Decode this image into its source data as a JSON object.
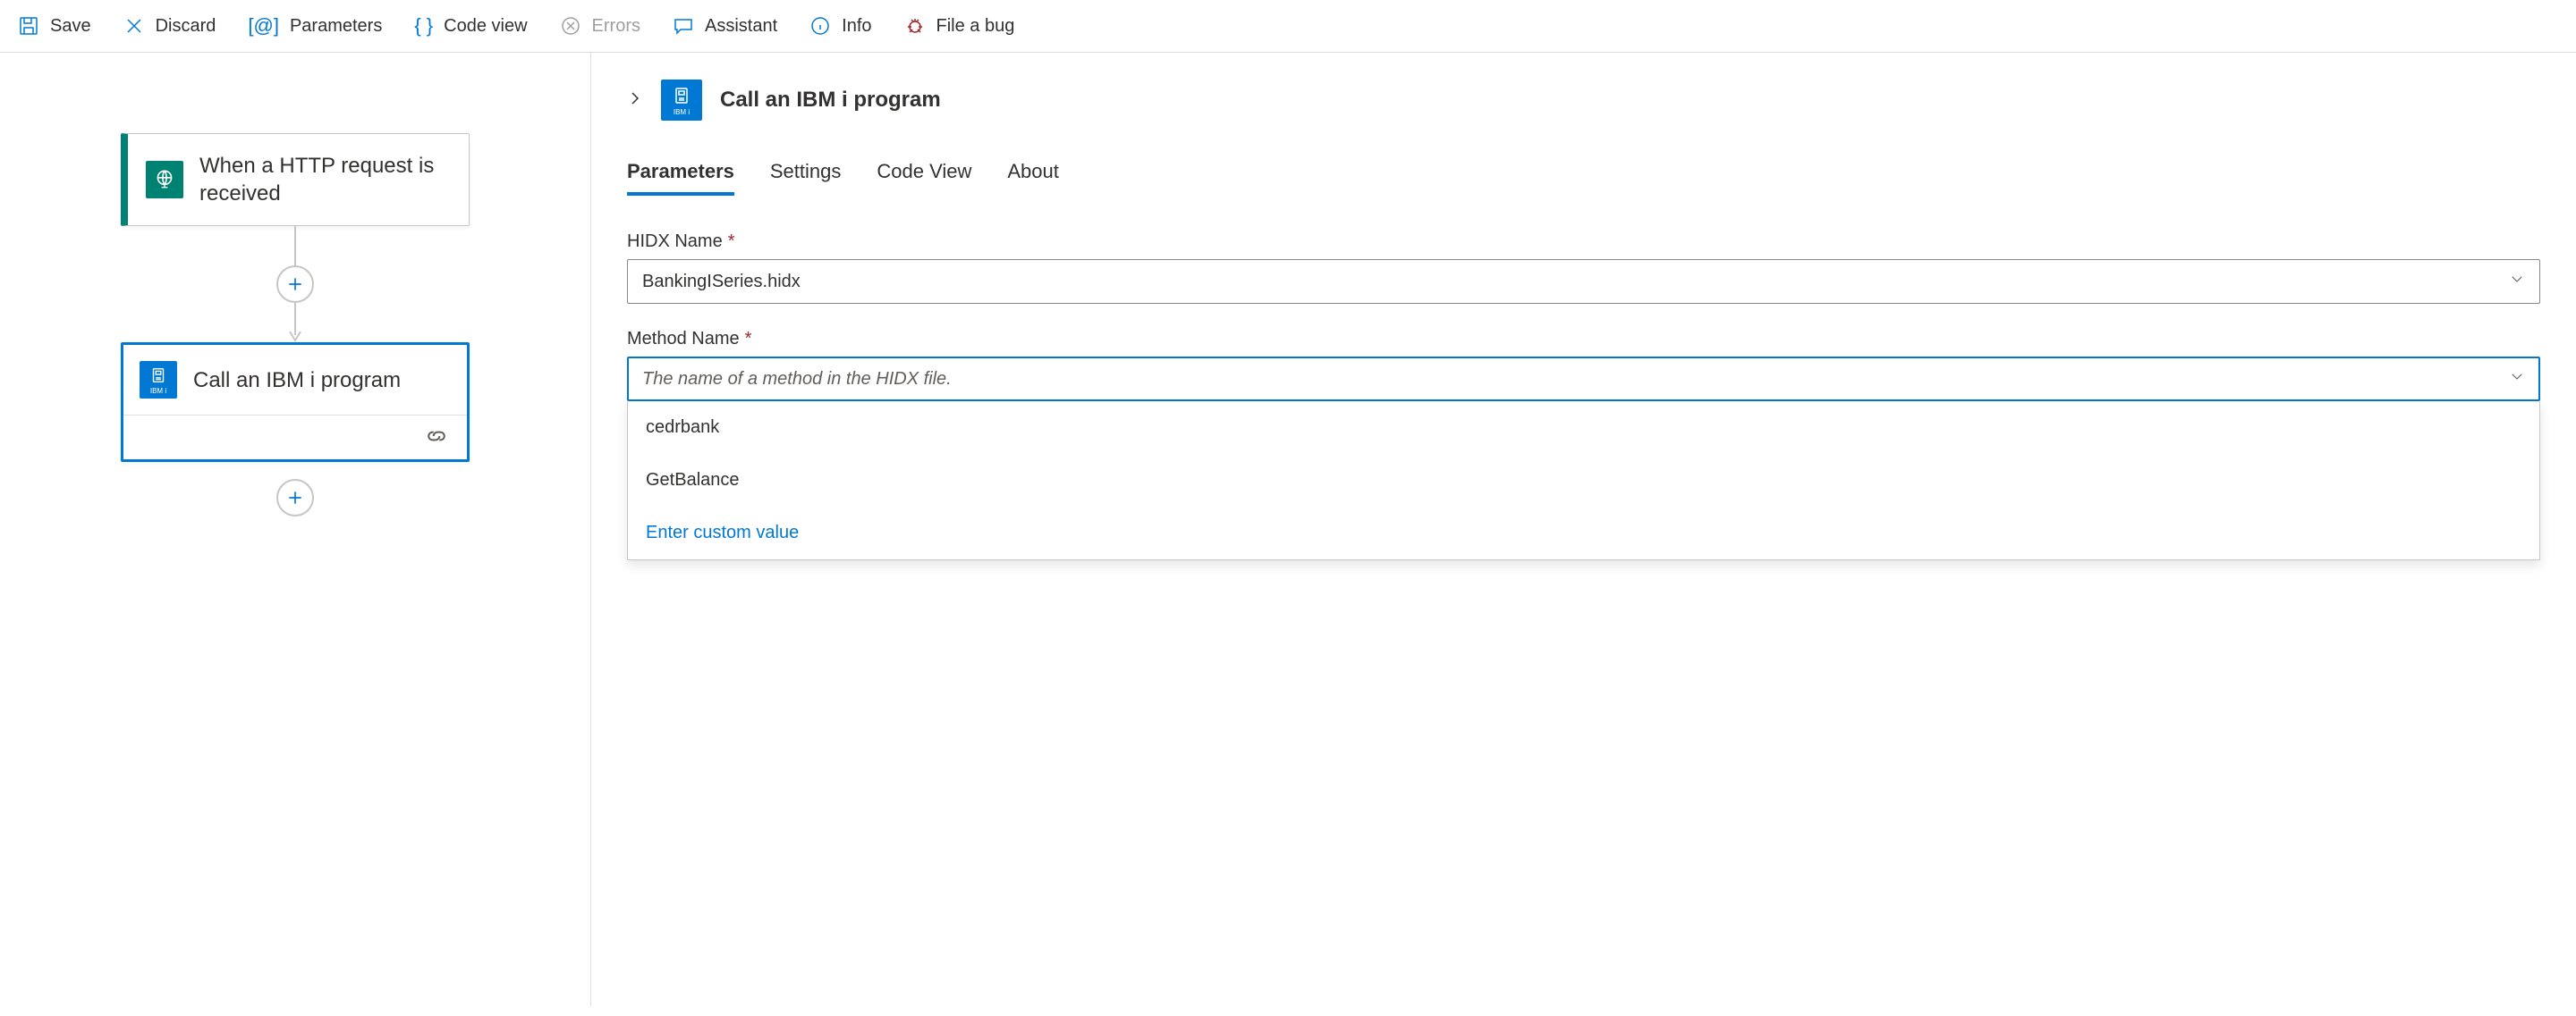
{
  "toolbar": {
    "save": "Save",
    "discard": "Discard",
    "parameters": "Parameters",
    "codeView": "Code view",
    "errors": "Errors",
    "assistant": "Assistant",
    "info": "Info",
    "fileBug": "File a bug"
  },
  "canvas": {
    "triggerNode": {
      "title": "When a HTTP request is received",
      "iconSub": ""
    },
    "actionNode": {
      "title": "Call an IBM i program",
      "iconSub": "IBM i"
    }
  },
  "pane": {
    "title": "Call an IBM i program",
    "iconSub": "IBM i",
    "tabs": {
      "parameters": "Parameters",
      "settings": "Settings",
      "codeView": "Code View",
      "about": "About"
    },
    "fields": {
      "hidxName": {
        "label": "HIDX Name",
        "value": "BankingISeries.hidx"
      },
      "methodName": {
        "label": "Method Name",
        "placeholder": "The name of a method in the HIDX file.",
        "options": [
          "cedrbank",
          "GetBalance"
        ],
        "customValueLabel": "Enter custom value"
      }
    }
  }
}
